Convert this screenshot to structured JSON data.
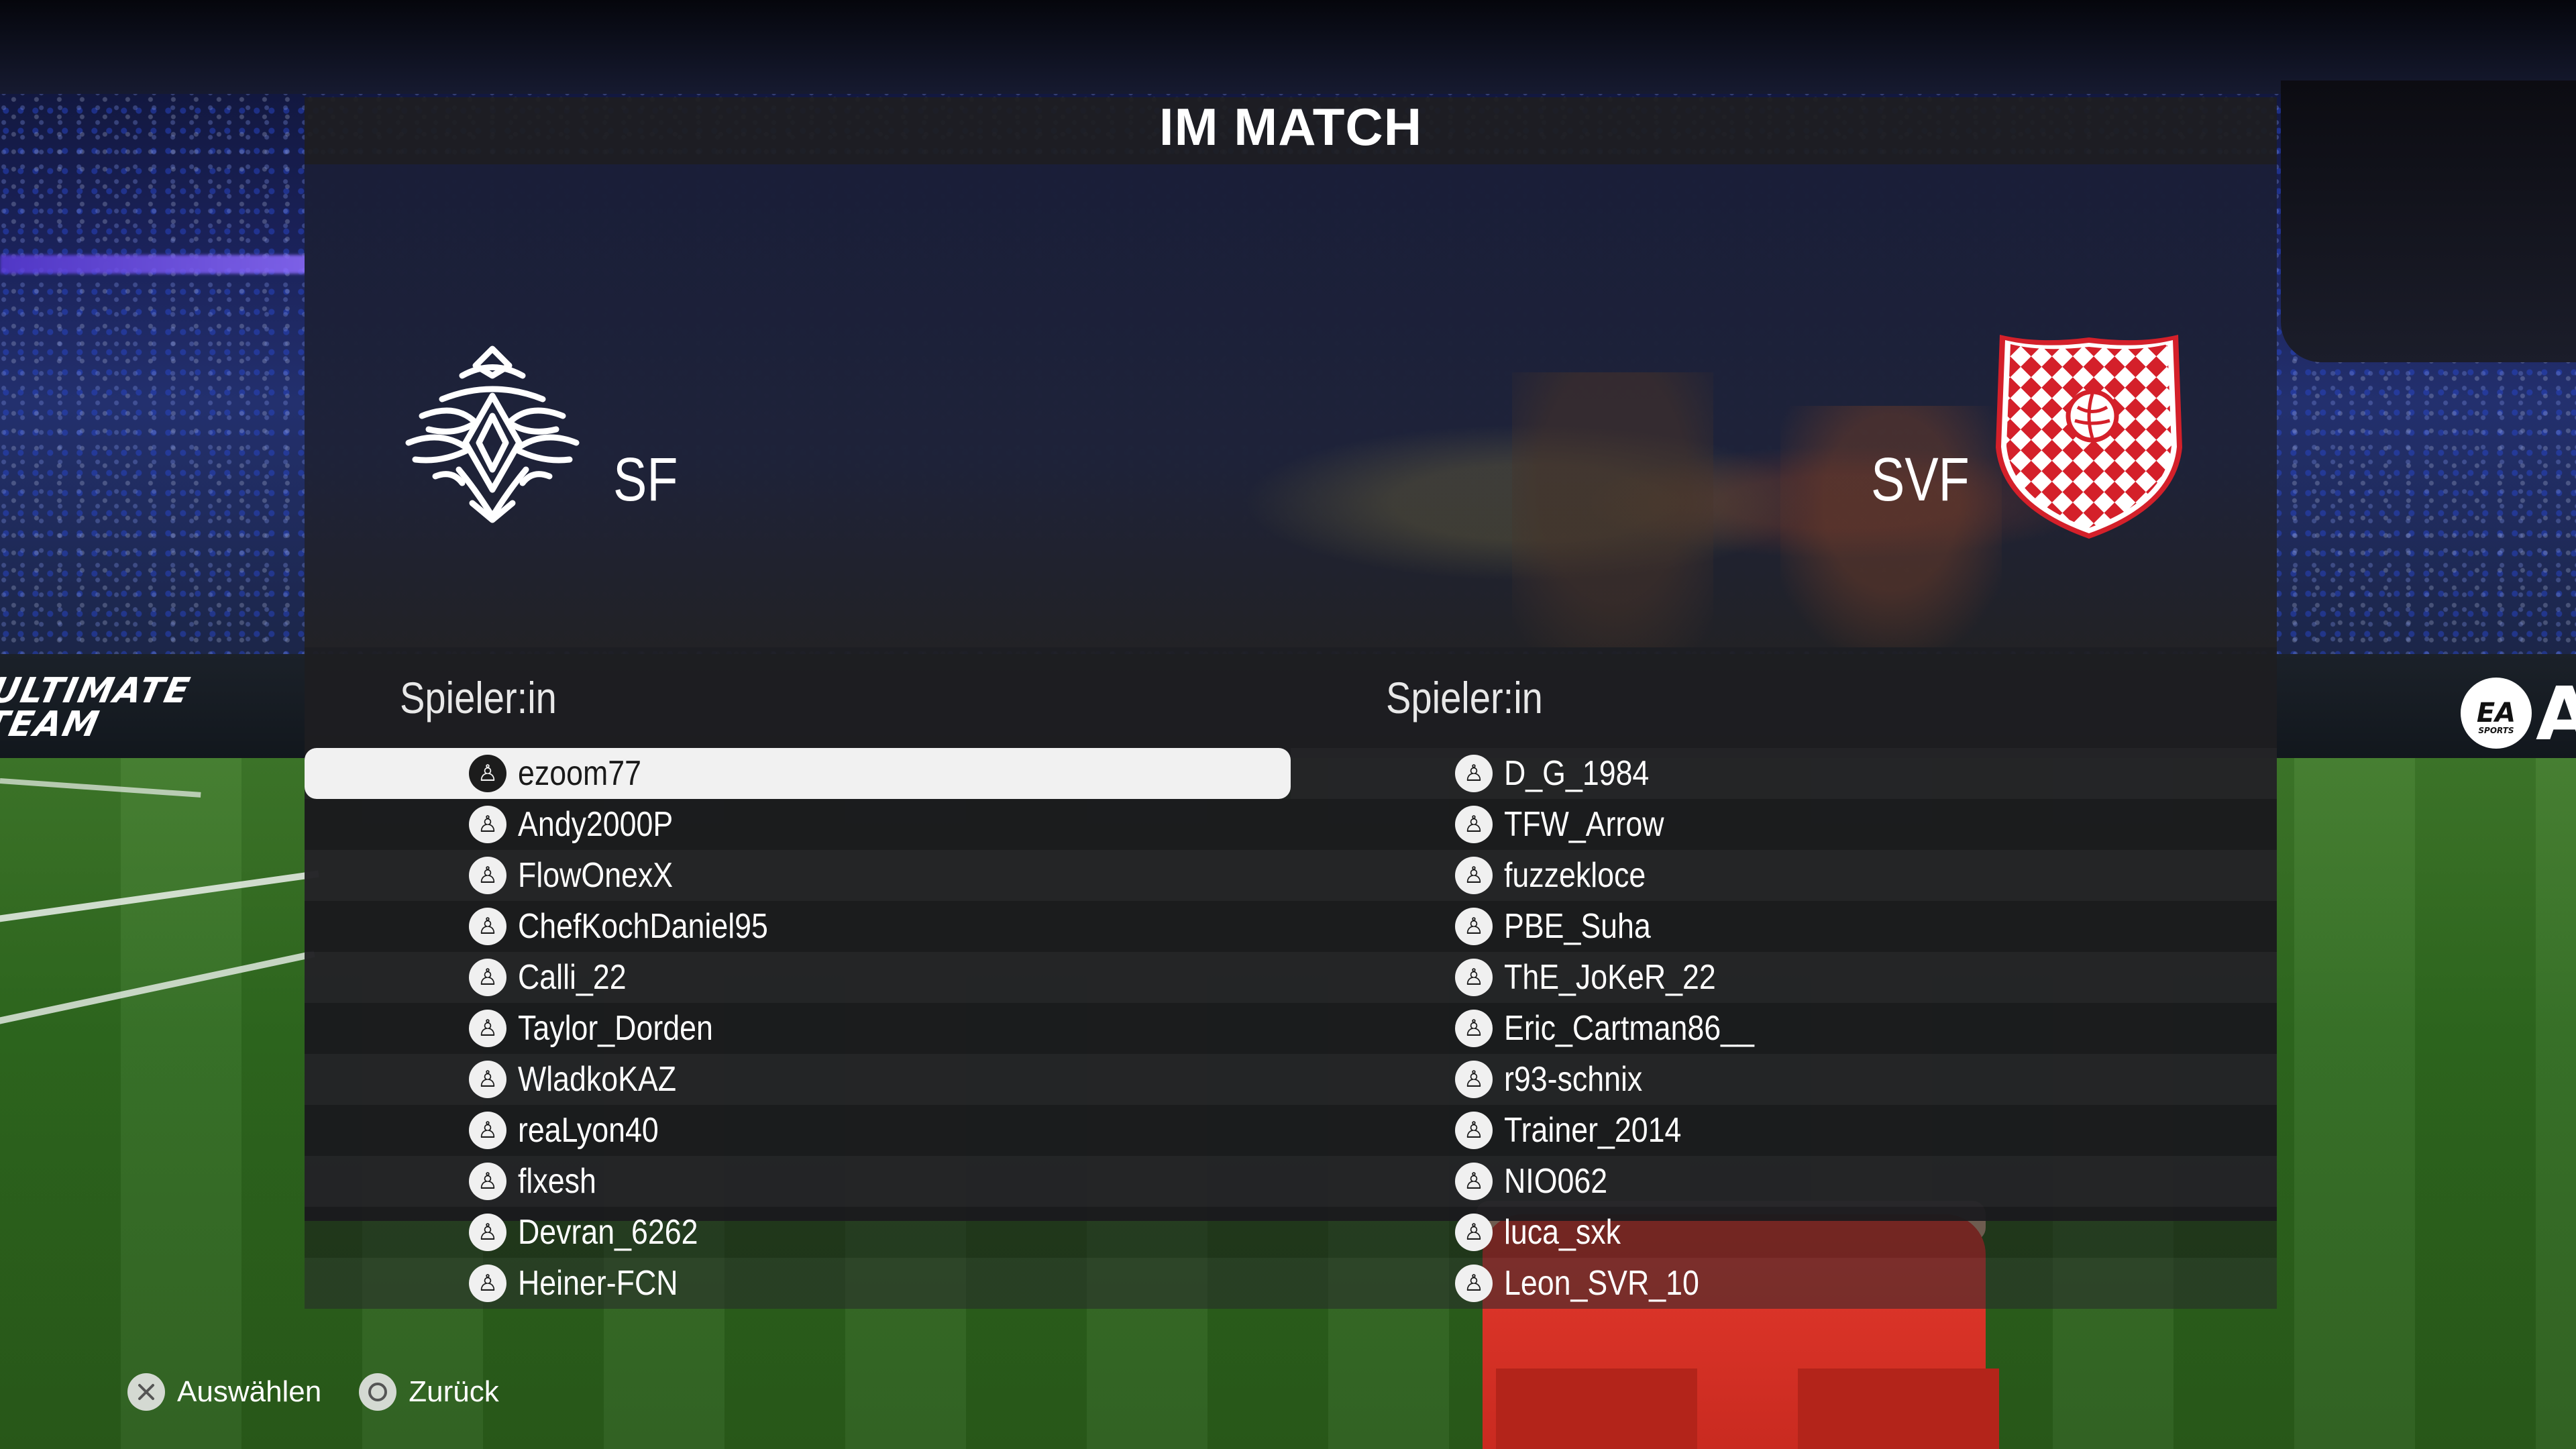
{
  "title": "IM MATCH",
  "teams": {
    "home": {
      "name": "SF",
      "column_header": "Spieler:in",
      "players": [
        "ezoom77",
        "Andy2000P",
        "FlowOnexX",
        "ChefKochDaniel95",
        "Calli_22",
        "Taylor_Dorden",
        "WladkoKAZ",
        "reaLyon40",
        "flxesh",
        "Devran_6262",
        "Heiner-FCN"
      ],
      "selected_index": 0
    },
    "away": {
      "name": "SVF",
      "column_header": "Spieler:in",
      "players": [
        "D_G_1984",
        "TFW_Arrow",
        "fuzzekloce",
        "PBE_Suha",
        "ThE_JoKeR_22",
        "Eric_Cartman86__",
        "r93-schnix",
        "Trainer_2014",
        "NIO062",
        "luca_sxk",
        "Leon_SVR_10"
      ]
    }
  },
  "platform_icon": "playstation-icon",
  "footer": {
    "select": {
      "label": "Auswählen",
      "icon": "cross-button-icon"
    },
    "back": {
      "label": "Zurück",
      "icon": "circle-button-icon"
    }
  },
  "background": {
    "ut_logo_lines": [
      "ULTIMATE",
      "TEAM"
    ],
    "ea_logo": "EA",
    "ea_logo_small": "SPORTS",
    "ea_fragment": "A"
  },
  "colors": {
    "panel": "#1e1e21",
    "selected_row": "#f1f1f1",
    "crest_red": "#d4202a"
  }
}
